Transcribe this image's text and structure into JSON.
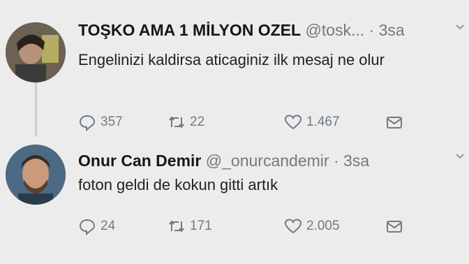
{
  "tweets": [
    {
      "name": "TOŞKO AMA 1 MİLYON OZEL",
      "handle": "@tosk...",
      "separator": "·",
      "time": "3sa",
      "text": "Engelinizi kaldirsa aticaginiz ilk mesaj ne olur",
      "replies": "357",
      "retweets": "22",
      "likes": "1.467"
    },
    {
      "name": "Onur Can Demir",
      "handle": "@_onurcandemir",
      "separator": "·",
      "time": "3sa",
      "text": "foton geldi de kokun gitti artık",
      "replies": "24",
      "retweets": "171",
      "likes": "2.005"
    }
  ],
  "icons": {
    "reply": "reply-icon",
    "retweet": "retweet-icon",
    "like": "heart-icon",
    "dm": "envelope-icon",
    "more": "chevron-down-icon"
  },
  "colors": {
    "text": "#14171a",
    "meta": "#6f7a84",
    "thread": "#c7cdd2",
    "background": "#ececec"
  }
}
